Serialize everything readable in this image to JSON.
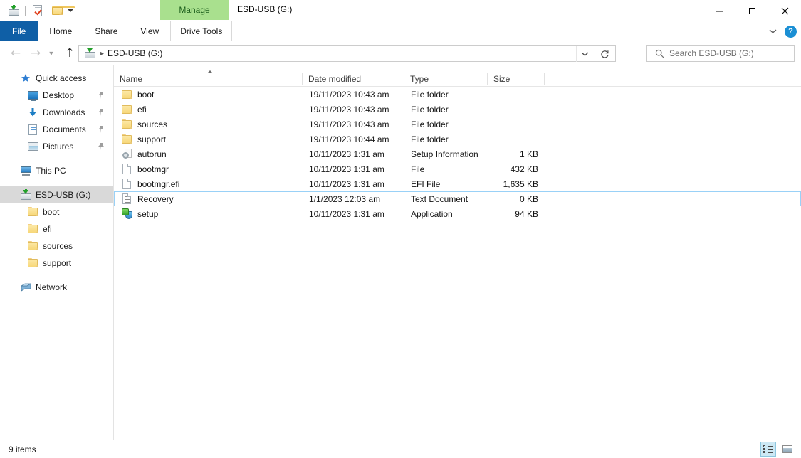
{
  "window": {
    "title": "ESD-USB (G:)",
    "contextual_tab_group": "Manage",
    "controls": {
      "minimize": "Minimize",
      "maximize": "Maximize",
      "close": "Close"
    }
  },
  "quick_access_toolbar": {
    "items": [
      {
        "name": "drive-icon",
        "label": "ESD-USB (G:)"
      },
      {
        "name": "properties-icon",
        "label": "Properties"
      },
      {
        "name": "new-folder-icon",
        "label": "New folder"
      },
      {
        "name": "customize-icon",
        "label": "Customize Quick Access Toolbar"
      }
    ]
  },
  "ribbon": {
    "tabs": [
      {
        "label": "File",
        "type": "file"
      },
      {
        "label": "Home",
        "type": "normal"
      },
      {
        "label": "Share",
        "type": "normal"
      },
      {
        "label": "View",
        "type": "normal"
      },
      {
        "label": "Drive Tools",
        "type": "contextual"
      }
    ],
    "expand_label": "Expand the Ribbon",
    "help_label": "?"
  },
  "address_bar": {
    "back_label": "Back",
    "forward_label": "Forward",
    "recent_label": "Recent locations",
    "up_label": "Up",
    "breadcrumb": [
      {
        "label": "ESD-USB (G:)"
      }
    ],
    "dropdown_label": "Previous locations",
    "refresh_label": "Refresh"
  },
  "search": {
    "placeholder": "Search ESD-USB (G:)"
  },
  "navigation_pane": {
    "items": [
      {
        "label": "Quick access",
        "icon": "star-icon",
        "indent": 0,
        "pinned": false,
        "selected": false
      },
      {
        "label": "Desktop",
        "icon": "desktop-icon",
        "indent": 1,
        "pinned": true,
        "selected": false
      },
      {
        "label": "Downloads",
        "icon": "download-icon",
        "indent": 1,
        "pinned": true,
        "selected": false
      },
      {
        "label": "Documents",
        "icon": "documents-icon",
        "indent": 1,
        "pinned": true,
        "selected": false
      },
      {
        "label": "Pictures",
        "icon": "pictures-icon",
        "indent": 1,
        "pinned": true,
        "selected": false
      },
      {
        "label": "This PC",
        "icon": "this-pc-icon",
        "indent": 0,
        "pinned": false,
        "selected": false,
        "gap_before": true
      },
      {
        "label": "ESD-USB (G:)",
        "icon": "drive-icon",
        "indent": 0,
        "pinned": false,
        "selected": true,
        "gap_before": true
      },
      {
        "label": "boot",
        "icon": "folder-icon",
        "indent": 1,
        "pinned": false,
        "selected": false
      },
      {
        "label": "efi",
        "icon": "folder-icon",
        "indent": 1,
        "pinned": false,
        "selected": false
      },
      {
        "label": "sources",
        "icon": "folder-icon",
        "indent": 1,
        "pinned": false,
        "selected": false
      },
      {
        "label": "support",
        "icon": "folder-icon",
        "indent": 1,
        "pinned": false,
        "selected": false
      },
      {
        "label": "Network",
        "icon": "network-icon",
        "indent": 0,
        "pinned": false,
        "selected": false,
        "gap_before": true
      }
    ]
  },
  "file_list": {
    "columns": [
      {
        "label": "Name",
        "key": "name",
        "sorted": "ascending"
      },
      {
        "label": "Date modified",
        "key": "date"
      },
      {
        "label": "Type",
        "key": "type"
      },
      {
        "label": "Size",
        "key": "size"
      }
    ],
    "rows": [
      {
        "name": "boot",
        "date": "19/11/2023 10:43 am",
        "type": "File folder",
        "size": "",
        "icon": "folder-icon",
        "focused": false
      },
      {
        "name": "efi",
        "date": "19/11/2023 10:43 am",
        "type": "File folder",
        "size": "",
        "icon": "folder-icon",
        "focused": false
      },
      {
        "name": "sources",
        "date": "19/11/2023 10:43 am",
        "type": "File folder",
        "size": "",
        "icon": "folder-icon",
        "focused": false
      },
      {
        "name": "support",
        "date": "19/11/2023 10:44 am",
        "type": "File folder",
        "size": "",
        "icon": "folder-icon",
        "focused": false
      },
      {
        "name": "autorun",
        "date": "10/11/2023 1:31 am",
        "type": "Setup Information",
        "size": "1 KB",
        "icon": "setup-information-icon",
        "focused": false
      },
      {
        "name": "bootmgr",
        "date": "10/11/2023 1:31 am",
        "type": "File",
        "size": "432 KB",
        "icon": "generic-file-icon",
        "focused": false
      },
      {
        "name": "bootmgr.efi",
        "date": "10/11/2023 1:31 am",
        "type": "EFI File",
        "size": "1,635 KB",
        "icon": "generic-file-icon",
        "focused": false
      },
      {
        "name": "Recovery",
        "date": "1/1/2023 12:03 am",
        "type": "Text Document",
        "size": "0 KB",
        "icon": "text-document-icon",
        "focused": true
      },
      {
        "name": "setup",
        "date": "10/11/2023 1:31 am",
        "type": "Application",
        "size": "94 KB",
        "icon": "application-icon",
        "focused": false
      }
    ]
  },
  "status_bar": {
    "item_count": "9 items",
    "view_buttons": [
      {
        "name": "details-view-button",
        "label": "Details view",
        "active": true
      },
      {
        "name": "large-icons-view-button",
        "label": "Large icons view",
        "active": false
      }
    ]
  },
  "colors": {
    "file_tab_blue": "#0f5fa6",
    "contextual_green": "#a9e08e",
    "contextual_green_text": "#1c5d1c",
    "selection_gray": "#d9d9d9",
    "focus_border": "#99d1f7",
    "folder_yellow": "#f7d779",
    "help_blue": "#1b8fd4"
  }
}
